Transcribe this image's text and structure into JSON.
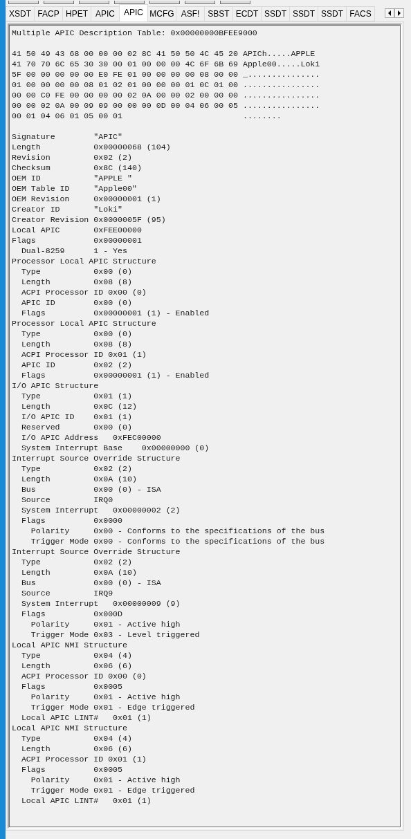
{
  "tabs": [
    {
      "label": "XSDT",
      "selected": false
    },
    {
      "label": "FACP",
      "selected": false
    },
    {
      "label": "HPET",
      "selected": false
    },
    {
      "label": "APIC",
      "selected": false
    },
    {
      "label": "APIC",
      "selected": true
    },
    {
      "label": "MCFG",
      "selected": false
    },
    {
      "label": "ASF!",
      "selected": false
    },
    {
      "label": "SBST",
      "selected": false
    },
    {
      "label": "ECDT",
      "selected": false
    },
    {
      "label": "SSDT",
      "selected": false
    },
    {
      "label": "SSDT",
      "selected": false
    },
    {
      "label": "SSDT",
      "selected": false
    },
    {
      "label": "FACS",
      "selected": false
    }
  ],
  "listing": {
    "title": "Multiple APIC Description Table: 0x00000000BFEE9000",
    "hex_dump": [
      {
        "bytes": "41 50 49 43 68 00 00 00 02 8C 41 50 50 4C 45 20",
        "ascii": "APICh.....APPLE"
      },
      {
        "bytes": "41 70 70 6C 65 30 30 00 01 00 00 00 4C 6F 6B 69",
        "ascii": "Apple00.....Loki"
      },
      {
        "bytes": "5F 00 00 00 00 00 E0 FE 01 00 00 00 00 08 00 00",
        "ascii": "_..............."
      },
      {
        "bytes": "01 00 00 00 00 08 01 02 01 00 00 00 01 0C 01 00",
        "ascii": "................"
      },
      {
        "bytes": "00 00 C0 FE 00 00 00 00 02 0A 00 00 02 00 00 00",
        "ascii": "................"
      },
      {
        "bytes": "00 00 02 0A 00 09 09 00 00 00 0D 00 04 06 00 05",
        "ascii": "................"
      },
      {
        "bytes": "00 01 04 06 01 05 00 01",
        "ascii": "........"
      }
    ],
    "fields": [
      {
        "line": "Signature        \"APIC\""
      },
      {
        "line": "Length           0x00000068 (104)"
      },
      {
        "line": "Revision         0x02 (2)"
      },
      {
        "line": "Checksum         0x8C (140)"
      },
      {
        "line": "OEM ID           \"APPLE \""
      },
      {
        "line": "OEM Table ID     \"Apple00\""
      },
      {
        "line": "OEM Revision     0x00000001 (1)"
      },
      {
        "line": "Creator ID       \"Loki\""
      },
      {
        "line": "Creator Revision 0x0000005F (95)"
      },
      {
        "line": "Local APIC       0xFEE00000"
      },
      {
        "line": "Flags            0x00000001",
        "children": [
          {
            "line": "Dual-8259      1 - Yes"
          }
        ]
      },
      {
        "line": "Processor Local APIC Structure",
        "children": [
          {
            "line": "Type           0x00 (0)"
          },
          {
            "line": "Length         0x08 (8)"
          },
          {
            "line": "ACPI Processor ID 0x00 (0)"
          },
          {
            "line": "APIC ID        0x00 (0)"
          },
          {
            "line": "Flags          0x00000001 (1) - Enabled"
          }
        ]
      },
      {
        "line": "Processor Local APIC Structure",
        "children": [
          {
            "line": "Type           0x00 (0)"
          },
          {
            "line": "Length         0x08 (8)"
          },
          {
            "line": "ACPI Processor ID 0x01 (1)"
          },
          {
            "line": "APIC ID        0x02 (2)"
          },
          {
            "line": "Flags          0x00000001 (1) - Enabled"
          }
        ]
      },
      {
        "line": "I/O APIC Structure",
        "children": [
          {
            "line": "Type           0x01 (1)"
          },
          {
            "line": "Length         0x0C (12)"
          },
          {
            "line": "I/O APIC ID    0x01 (1)"
          },
          {
            "line": "Reserved       0x00 (0)"
          },
          {
            "line": "I/O APIC Address   0xFEC00000"
          },
          {
            "line": "System Interrupt Base    0x00000000 (0)"
          }
        ]
      },
      {
        "line": "Interrupt Source Override Structure",
        "children": [
          {
            "line": "Type           0x02 (2)"
          },
          {
            "line": "Length         0x0A (10)"
          },
          {
            "line": "Bus            0x00 (0) - ISA"
          },
          {
            "line": "Source         IRQ0"
          },
          {
            "line": "System Interrupt   0x00000002 (2)"
          },
          {
            "line": "Flags          0x0000",
            "children": [
              {
                "line": "Polarity     0x00 - Conforms to the specifications of the bus"
              },
              {
                "line": "Trigger Mode 0x00 - Conforms to the specifications of the bus"
              }
            ]
          }
        ]
      },
      {
        "line": "Interrupt Source Override Structure",
        "children": [
          {
            "line": "Type           0x02 (2)"
          },
          {
            "line": "Length         0x0A (10)"
          },
          {
            "line": "Bus            0x00 (0) - ISA"
          },
          {
            "line": "Source         IRQ9"
          },
          {
            "line": "System Interrupt   0x00000009 (9)"
          },
          {
            "line": "Flags          0x000D",
            "children": [
              {
                "line": "Polarity     0x01 - Active high"
              },
              {
                "line": "Trigger Mode 0x03 - Level triggered"
              }
            ]
          }
        ]
      },
      {
        "line": "Local APIC NMI Structure",
        "children": [
          {
            "line": "Type           0x04 (4)"
          },
          {
            "line": "Length         0x06 (6)"
          },
          {
            "line": "ACPI Processor ID 0x00 (0)"
          },
          {
            "line": "Flags          0x0005",
            "children": [
              {
                "line": "Polarity     0x01 - Active high"
              },
              {
                "line": "Trigger Mode 0x01 - Edge triggered"
              }
            ]
          },
          {
            "line": "Local APIC LINT#   0x01 (1)"
          }
        ]
      },
      {
        "line": "Local APIC NMI Structure",
        "children": [
          {
            "line": "Type           0x04 (4)"
          },
          {
            "line": "Length         0x06 (6)"
          },
          {
            "line": "ACPI Processor ID 0x01 (1)"
          },
          {
            "line": "Flags          0x0005",
            "children": [
              {
                "line": "Polarity     0x01 - Active high"
              },
              {
                "line": "Trigger Mode 0x01 - Edge triggered"
              }
            ]
          },
          {
            "line": "Local APIC LINT#   0x01 (1)"
          }
        ]
      }
    ]
  }
}
